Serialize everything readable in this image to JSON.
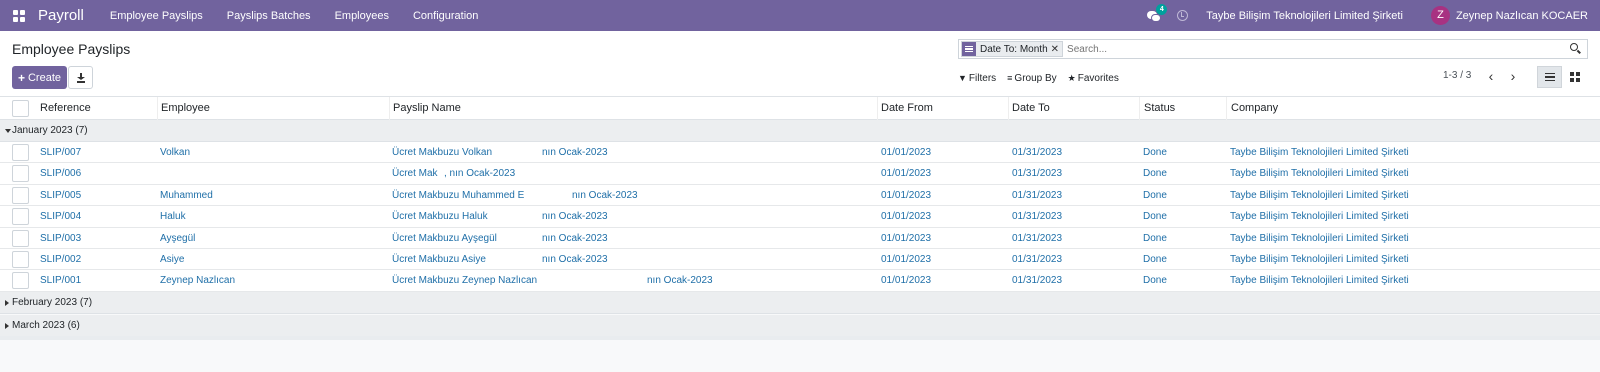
{
  "navbar": {
    "app_name": "Payroll",
    "menu": [
      "Employee Payslips",
      "Payslips Batches",
      "Employees",
      "Configuration"
    ],
    "chat_badge": "4",
    "company": "Taybe Bilişim Teknolojileri Limited Şirketi",
    "avatar_letter": "Z",
    "user": "Zeynep Nazlıcan KOCAER",
    "accent_color": "#71639e"
  },
  "control_panel": {
    "title": "Employee Payslips",
    "create_label": "Create",
    "facet_value": "Date To: Month",
    "search_placeholder": "Search...",
    "filters_label": "Filters",
    "groupby_label": "Group By",
    "favorites_label": "Favorites",
    "pager": "1-3 / 3"
  },
  "table": {
    "columns": [
      "Reference",
      "Employee",
      "Payslip Name",
      "Date From",
      "Date To",
      "Status",
      "Company"
    ],
    "groups": [
      {
        "label": "January 2023 (7)",
        "expanded": true,
        "rows": [
          {
            "ref": "SLIP/007",
            "employee": "Volkan",
            "name": "Ücret Makbuzu Volkan",
            "name_tail": "nın Ocak-2023",
            "from": "01/01/2023",
            "to": "01/31/2023",
            "status": "Done",
            "company": "Taybe Bilişim Teknolojileri Limited Şirketi"
          },
          {
            "ref": "SLIP/006",
            "employee": "",
            "name": "Ücret Mak",
            "name_tail": ", nın Ocak-2023",
            "from": "01/01/2023",
            "to": "01/31/2023",
            "status": "Done",
            "company": "Taybe Bilişim Teknolojileri Limited Şirketi"
          },
          {
            "ref": "SLIP/005",
            "employee": "Muhammed",
            "name": "Ücret Makbuzu Muhammed E",
            "name_tail": "nın Ocak-2023",
            "from": "01/01/2023",
            "to": "01/31/2023",
            "status": "Done",
            "company": "Taybe Bilişim Teknolojileri Limited Şirketi"
          },
          {
            "ref": "SLIP/004",
            "employee": "Haluk",
            "name": "Ücret Makbuzu Haluk",
            "name_tail": "nın Ocak-2023",
            "from": "01/01/2023",
            "to": "01/31/2023",
            "status": "Done",
            "company": "Taybe Bilişim Teknolojileri Limited Şirketi"
          },
          {
            "ref": "SLIP/003",
            "employee": "Ayşegül",
            "name": "Ücret Makbuzu Ayşegül",
            "name_tail": "nın Ocak-2023",
            "from": "01/01/2023",
            "to": "01/31/2023",
            "status": "Done",
            "company": "Taybe Bilişim Teknolojileri Limited Şirketi"
          },
          {
            "ref": "SLIP/002",
            "employee": "Asiye",
            "name": "Ücret Makbuzu Asiye",
            "name_tail": "nın Ocak-2023",
            "from": "01/01/2023",
            "to": "01/31/2023",
            "status": "Done",
            "company": "Taybe Bilişim Teknolojileri Limited Şirketi"
          },
          {
            "ref": "SLIP/001",
            "employee": "Zeynep Nazlıcan",
            "name": "Ücret Makbuzu Zeynep Nazlıcan",
            "name_tail": "nın Ocak-2023",
            "from": "01/01/2023",
            "to": "01/31/2023",
            "status": "Done",
            "company": "Taybe Bilişim Teknolojileri Limited Şirketi"
          }
        ]
      },
      {
        "label": "February 2023 (7)",
        "expanded": false
      },
      {
        "label": "March 2023 (6)",
        "expanded": false
      }
    ]
  }
}
